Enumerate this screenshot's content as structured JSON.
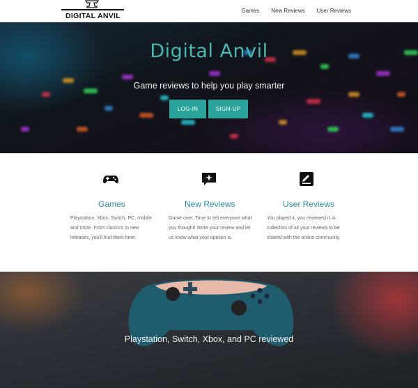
{
  "header": {
    "logo_text": "DIGITAL ANVIL",
    "nav": [
      "Games",
      "New Reviews",
      "User Reviews"
    ]
  },
  "hero": {
    "title": "Digital Anvil",
    "subtitle": "Game reviews to help you play smarter",
    "login_label": "LOG-IN",
    "signup_label": "SIGN-UP"
  },
  "features": [
    {
      "icon": "gamepad-icon",
      "title": "Games",
      "description": "Playstation, Xbox, Switch, PC, mobile and more. From classics to new releases, you'll find them here."
    },
    {
      "icon": "sparkle-chat-icon",
      "title": "New Reviews",
      "description": "Game over. Time to tell everyone what you thought! Write your review and let us know what your opinion is."
    },
    {
      "icon": "edit-square-icon",
      "title": "User Reviews",
      "description": "You played it, you reviewed it. A collection of all your reviews to be shared with the online community."
    }
  ],
  "banner": {
    "text": "Playstation, Switch, Xbox, and PC reviewed"
  },
  "colors": {
    "accent": "#2aa39a",
    "title_teal": "#4ab8b0",
    "feature_title": "#2b8fa6"
  }
}
